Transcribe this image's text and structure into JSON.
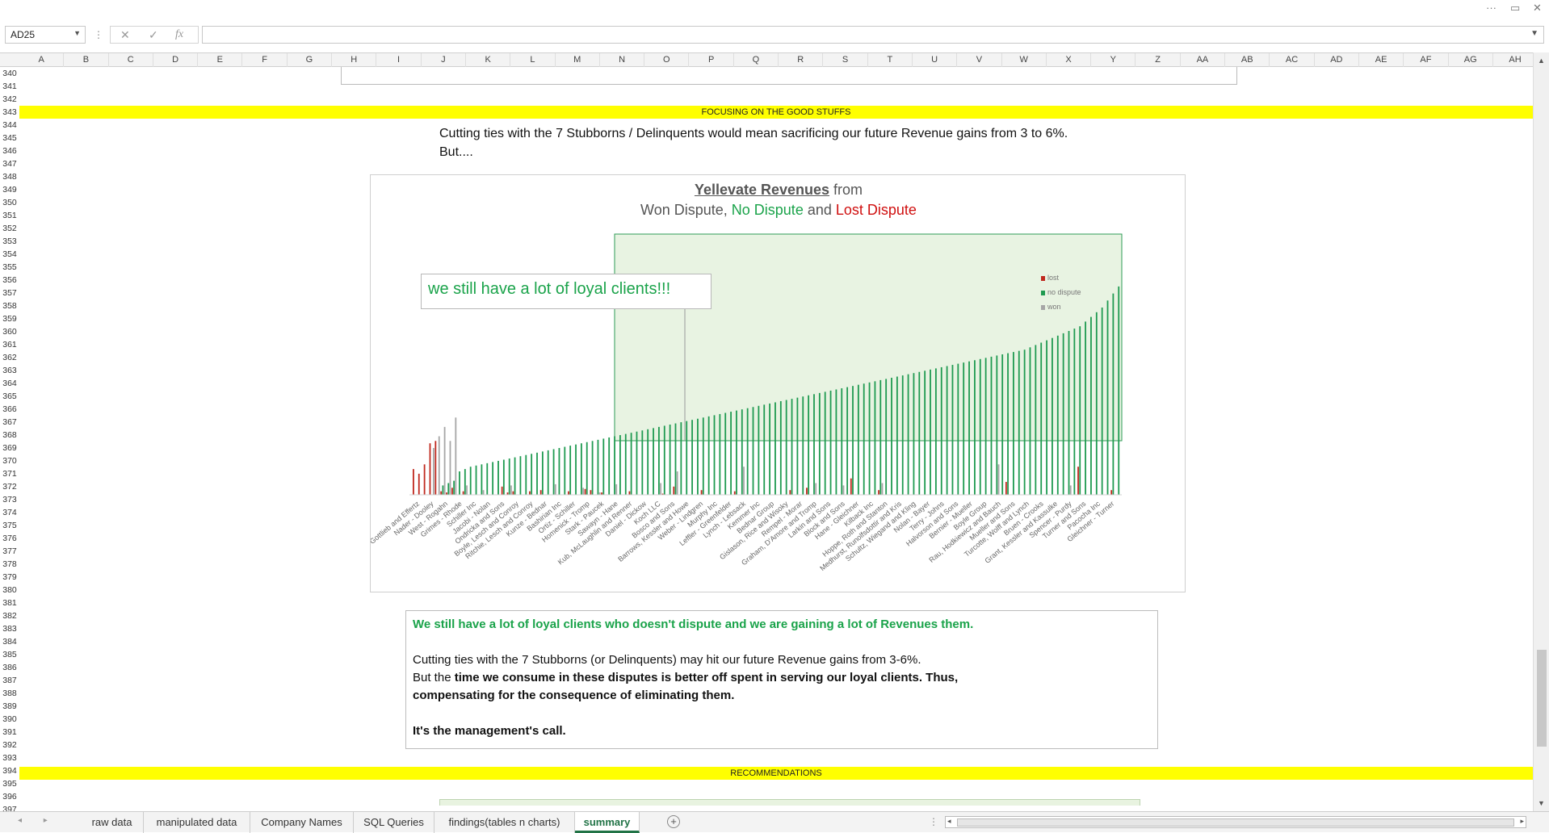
{
  "window": {
    "more_icon": "ellipsis-icon",
    "restore_icon": "window-restore-icon",
    "close_icon": "close-icon",
    "more_glyph": "···",
    "restore_glyph": "▭",
    "close_glyph": "✕"
  },
  "formula_bar": {
    "name_box": "AD25",
    "cancel_glyph": "✕",
    "enter_glyph": "✓",
    "fx_glyph": "fx",
    "formula": ""
  },
  "columns": [
    "A",
    "B",
    "C",
    "D",
    "E",
    "F",
    "G",
    "H",
    "I",
    "J",
    "K",
    "L",
    "M",
    "N",
    "O",
    "P",
    "Q",
    "R",
    "S",
    "T",
    "U",
    "V",
    "W",
    "X",
    "Y",
    "Z",
    "AA",
    "AB",
    "AC",
    "AD",
    "AE",
    "AF",
    "AG",
    "AH"
  ],
  "rows": [
    "340",
    "341",
    "342",
    "343",
    "344",
    "345",
    "346",
    "347",
    "348",
    "349",
    "350",
    "351",
    "352",
    "353",
    "354",
    "355",
    "356",
    "357",
    "358",
    "359",
    "360",
    "361",
    "362",
    "363",
    "364",
    "365",
    "366",
    "367",
    "368",
    "369",
    "370",
    "371",
    "372",
    "373",
    "374",
    "375",
    "376",
    "377",
    "378",
    "379",
    "380",
    "381",
    "382",
    "383",
    "384",
    "385",
    "386",
    "387",
    "388",
    "389",
    "390",
    "391",
    "392",
    "393",
    "394",
    "395",
    "396",
    "397"
  ],
  "sheet": {
    "band_good": "FOCUSING ON THE GOOD STUFFS",
    "band_recommendations": "RECOMMENDATIONS",
    "intro_line1": "Cutting ties with the 7 Stubborns / Delinquents would mean sacrificing our future Revenue gains from 3 to 6%.",
    "intro_line2": "But...."
  },
  "chart": {
    "title_underlined": "Yellevate Revenues",
    "title_rest": " from",
    "subtitle_part1": "Won Dispute, ",
    "subtitle_part2": "No Dispute",
    "subtitle_part3": " and ",
    "subtitle_part4": "Lost Dispute",
    "callout": "we still have a lot of loyal clients!!!",
    "colors": {
      "lost": "#c0281e",
      "no_dispute": "#1e9a50",
      "won": "#a6a6a6",
      "highlight_fill": "#e8f3e2",
      "highlight_border": "#2e9b55"
    }
  },
  "chart_data": {
    "type": "bar",
    "legend": [
      "lost",
      "no dispute",
      "won"
    ],
    "categories": [
      "Metz, Gottlieb and Effertz",
      "Nader - Dooley",
      "West - Rogahn",
      "Grimes - Rhode",
      "Schiller Inc",
      "Jacobi - Nolan",
      "Ondricka and Sons",
      "Boyle, Lesch and Conroy",
      "Ritchie, Lesch and Conroy",
      "Kunze - Bednar",
      "Bashirian Inc",
      "Ortiz - Schiller",
      "Homenick - Tromp",
      "Stark - Paucek",
      "Sawayn - Hane",
      "Kub, McLaughlin and Renner",
      "Daniel - Dickow",
      "Koch LLC",
      "Bosco and Sons",
      "Barrows, Kessler and Howe",
      "Weber - Lindgren",
      "Murphy Inc",
      "Leffler - Greenfelder",
      "Lynch - Lebsack",
      "Kemmer Inc",
      "Bednar Group",
      "Gislason, Rice and Wisoky",
      "Rempel - Morar",
      "Graham, D'Amore and Tromp",
      "Larkin and Sons",
      "Block and Sons",
      "Hane - Gleichner",
      "Kilback Inc",
      "Hoppe, Roth and Stanton",
      "Medhurst, Runolfsdottir and Kris",
      "Schultz, Wiegand and Kling",
      "Nolan - Bayer",
      "Terry - Johns",
      "Halvorson and Sons",
      "Bernier - Mueller",
      "Boyle Group",
      "Rau, Hodkiewicz and Bauch",
      "Mueller and Sons",
      "Turcotte, Wolff and Lynch",
      "Bruen - Crooks",
      "Grant, Kessler and Kassulke",
      "Spencer - Purdy",
      "Turner and Sons",
      "Pacocha Inc",
      "Gleichner - Turner"
    ],
    "series": [
      {
        "name": "lost",
        "values": [
          22,
          18,
          26,
          44,
          46,
          3,
          2,
          6,
          0,
          3,
          0,
          0,
          0,
          0,
          0,
          0,
          7,
          2,
          3,
          0,
          0,
          3,
          0,
          4,
          0,
          0,
          0,
          0,
          3,
          0,
          0,
          5,
          4,
          0,
          2,
          0,
          0,
          0,
          0,
          3,
          0,
          0,
          0,
          0,
          0,
          1,
          0,
          7,
          0,
          0,
          0,
          0,
          4,
          0,
          0,
          0,
          0,
          0,
          3,
          0,
          0,
          0,
          0,
          0,
          0,
          0,
          0,
          0,
          4,
          0,
          0,
          6,
          0,
          0,
          0,
          0,
          0,
          0,
          0,
          14,
          0,
          0,
          0,
          0,
          4,
          0,
          0,
          0,
          0,
          0,
          0,
          0,
          0,
          0,
          0,
          0,
          0,
          0,
          0,
          0,
          0,
          0,
          0,
          0,
          0,
          0,
          0,
          11,
          0,
          0,
          0,
          0,
          0,
          0,
          0,
          0,
          0,
          0,
          0,
          0,
          24,
          0,
          0,
          0,
          0,
          0,
          4,
          0
        ]
      },
      {
        "name": "no dispute",
        "values": [
          0,
          0,
          0,
          0,
          0,
          8,
          10,
          12,
          20,
          22,
          24,
          25,
          26,
          27,
          28,
          29,
          30,
          31,
          32,
          33,
          34,
          35,
          36,
          37,
          38,
          39,
          40,
          41,
          42,
          43,
          44,
          45,
          46,
          47,
          48,
          49,
          50,
          51,
          52,
          53,
          54,
          55,
          56,
          57,
          58,
          59,
          60,
          61,
          62,
          63,
          64,
          65,
          66,
          67,
          68,
          69,
          70,
          71,
          72,
          73,
          74,
          75,
          76,
          77,
          78,
          79,
          80,
          81,
          82,
          83,
          84,
          85,
          86,
          87,
          88,
          89,
          90,
          91,
          92,
          93,
          94,
          95,
          96,
          97,
          98,
          99,
          100,
          101,
          102,
          103,
          104,
          105,
          106,
          107,
          108,
          109,
          110,
          111,
          112,
          113,
          114,
          115,
          116,
          117,
          118,
          119,
          120,
          121,
          122,
          123,
          124,
          126,
          128,
          130,
          132,
          134,
          136,
          138,
          140,
          142,
          144,
          148,
          152,
          156,
          160,
          166,
          172,
          178
        ]
      },
      {
        "name": "won",
        "values": [
          0,
          0,
          0,
          40,
          50,
          58,
          46,
          66,
          0,
          8,
          0,
          0,
          4,
          0,
          0,
          0,
          0,
          8,
          0,
          0,
          0,
          0,
          0,
          0,
          0,
          9,
          0,
          0,
          0,
          0,
          6,
          0,
          0,
          2,
          0,
          0,
          9,
          0,
          0,
          0,
          0,
          0,
          0,
          0,
          10,
          0,
          0,
          20,
          0,
          0,
          0,
          0,
          0,
          0,
          0,
          0,
          0,
          0,
          0,
          24,
          0,
          0,
          0,
          0,
          0,
          0,
          0,
          0,
          0,
          0,
          0,
          0,
          10,
          0,
          0,
          0,
          0,
          8,
          0,
          0,
          0,
          0,
          0,
          0,
          10,
          0,
          0,
          0,
          0,
          0,
          0,
          0,
          0,
          0,
          0,
          0,
          0,
          0,
          0,
          0,
          0,
          0,
          0,
          0,
          0,
          26,
          0,
          0,
          0,
          0,
          0,
          0,
          0,
          0,
          0,
          0,
          0,
          0,
          8,
          0,
          0,
          0,
          0,
          0,
          0,
          0
        ]
      }
    ],
    "ylim": [
      0,
      200
    ]
  },
  "notes": {
    "headline": "We still have a lot of loyal clients who doesn't dispute and we are gaining a lot of Revenues them.",
    "line1": "Cutting ties with the 7 Stubborns (or Delinquents) may hit our future Revenue gains from 3-6%.",
    "line2_plain": "But the ",
    "line2_bold": "time we consume in these disputes is better off spent in serving our loyal clients. Thus,",
    "line3_bold": "compensating for the consequence of eliminating them.",
    "line4_bold": "It's the management's call."
  },
  "tabs": [
    {
      "label": "raw data",
      "active": false
    },
    {
      "label": "manipulated data",
      "active": false
    },
    {
      "label": "Company Names",
      "active": false
    },
    {
      "label": "SQL Queries",
      "active": false
    },
    {
      "label": "findings(tables n charts)",
      "active": false
    },
    {
      "label": "summary",
      "active": true
    }
  ],
  "tab_nav_glyphs": "◂ ▸",
  "add_sheet_glyph": "+",
  "scroll_glyphs": {
    "up": "▲",
    "down": "▼",
    "left": "◂",
    "right": "▸"
  }
}
